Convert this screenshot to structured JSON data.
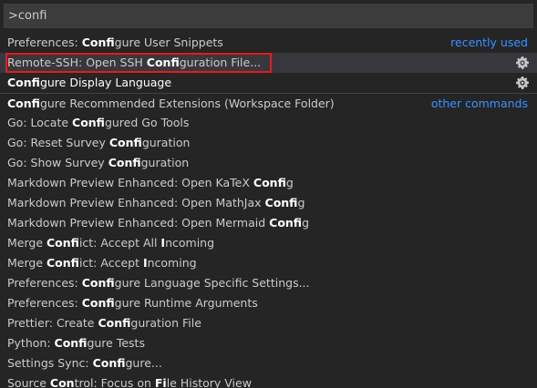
{
  "search": {
    "value": ">confi",
    "placeholder": ""
  },
  "colors": {
    "accent": "#3794ff",
    "highlight_border": "#e31c1c",
    "selected_bg": "#37373d"
  },
  "items": [
    {
      "pre": "Preferences: ",
      "bold": "Confi",
      "post": "gure User Snippets",
      "group": "recently used",
      "gear": false
    },
    {
      "pre": "Remote-SSH: Open SSH ",
      "bold": "Confi",
      "post": "guration File...",
      "group": "",
      "gear": true
    },
    {
      "pre": "",
      "bold": "Confi",
      "post": "gure Display Language",
      "group": "",
      "gear": true
    },
    {
      "pre": "",
      "bold": "Confi",
      "post": "gure Recommended Extensions (Workspace Folder)",
      "group": "other commands",
      "gear": false
    },
    {
      "pre": "Go: Locate ",
      "bold": "Confi",
      "post": "gured Go Tools"
    },
    {
      "pre": "Go: Reset Survey ",
      "bold": "Confi",
      "post": "guration"
    },
    {
      "pre": "Go: Show Survey ",
      "bold": "Confi",
      "post": "guration"
    },
    {
      "pre": "Markdown Preview Enhanced: Open KaTeX ",
      "bold": "Confi",
      "post": "g"
    },
    {
      "pre": "Markdown Preview Enhanced: Open MathJax ",
      "bold": "Confi",
      "post": "g"
    },
    {
      "pre": "Markdown Preview Enhanced: Open Mermaid ",
      "bold": "Confi",
      "post": "g"
    },
    {
      "pre": "Merge ",
      "bold": "Confi",
      "post": "ict: Accept All ",
      "bold2": "I",
      "post2": "ncoming"
    },
    {
      "pre": "Merge ",
      "bold": "Confi",
      "post": "ict: Accept ",
      "bold2": "I",
      "post2": "ncoming"
    },
    {
      "pre": "Preferences: ",
      "bold": "Confi",
      "post": "gure Language Specific Settings..."
    },
    {
      "pre": "Preferences: ",
      "bold": "Confi",
      "post": "gure Runtime Arguments"
    },
    {
      "pre": "Prettier: Create ",
      "bold": "Confi",
      "post": "guration File"
    },
    {
      "pre": "Python: ",
      "bold": "Confi",
      "post": "gure Tests"
    },
    {
      "pre": "Settings Sync: ",
      "bold": "Confi",
      "post": "gure..."
    },
    {
      "pre": "Source ",
      "bold": "Con",
      "post": "trol: Focus on ",
      "bold2": "Fi",
      "post2": "le History View"
    }
  ]
}
